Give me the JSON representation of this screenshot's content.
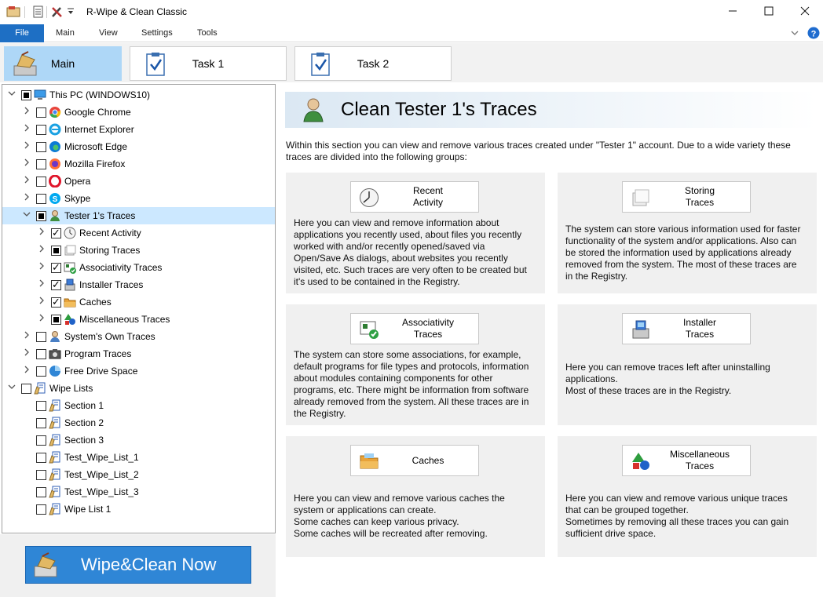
{
  "window": {
    "title": "R-Wipe & Clean Classic",
    "minimize_icon": "minimize-icon",
    "maximize_icon": "maximize-icon",
    "close_icon": "close-icon"
  },
  "quick_access": [
    "app-icon",
    "properties-icon",
    "tools-icon",
    "dropdown-icon"
  ],
  "menu": {
    "items": [
      "File",
      "Main",
      "View",
      "Settings",
      "Tools"
    ],
    "help_icon": "help-icon",
    "chevron": "chevron-down-icon"
  },
  "tabs": [
    {
      "label": "Main",
      "icon": "broom-icon",
      "active": true
    },
    {
      "label": "Task 1",
      "icon": "clipboard-check-icon",
      "active": false
    },
    {
      "label": "Task 2",
      "icon": "clipboard-check-icon",
      "active": false
    }
  ],
  "tree": [
    {
      "label": "This PC  (WINDOWS10)",
      "level": 0,
      "expander": "expanded",
      "check": "partial",
      "icon": "computer-icon"
    },
    {
      "label": "Google Chrome",
      "level": 1,
      "expander": "collapsed",
      "check": "unchecked",
      "icon": "chrome-icon"
    },
    {
      "label": "Internet  Explorer",
      "level": 1,
      "expander": "collapsed",
      "check": "unchecked",
      "icon": "ie-icon"
    },
    {
      "label": "Microsoft Edge",
      "level": 1,
      "expander": "collapsed",
      "check": "unchecked",
      "icon": "edge-icon"
    },
    {
      "label": "Mozilla Firefox",
      "level": 1,
      "expander": "collapsed",
      "check": "unchecked",
      "icon": "firefox-icon"
    },
    {
      "label": "Opera",
      "level": 1,
      "expander": "collapsed",
      "check": "unchecked",
      "icon": "opera-icon"
    },
    {
      "label": "Skype",
      "level": 1,
      "expander": "collapsed",
      "check": "unchecked",
      "icon": "skype-icon"
    },
    {
      "label": "Tester 1's Traces",
      "level": 1,
      "expander": "expanded",
      "check": "partial",
      "icon": "user-icon",
      "selected": true
    },
    {
      "label": "Recent Activity",
      "level": 2,
      "expander": "collapsed",
      "check": "checked",
      "icon": "clock-icon"
    },
    {
      "label": "Storing Traces",
      "level": 2,
      "expander": "collapsed",
      "check": "partial",
      "icon": "storage-icon"
    },
    {
      "label": "Associativity Traces",
      "level": 2,
      "expander": "collapsed",
      "check": "checked",
      "icon": "association-icon"
    },
    {
      "label": "Installer Traces",
      "level": 2,
      "expander": "collapsed",
      "check": "checked",
      "icon": "installer-icon"
    },
    {
      "label": "Caches",
      "level": 2,
      "expander": "collapsed",
      "check": "checked",
      "icon": "folder-icon"
    },
    {
      "label": "Miscellaneous Traces",
      "level": 2,
      "expander": "collapsed",
      "check": "partial",
      "icon": "shapes-icon"
    },
    {
      "label": "System's Own Traces",
      "level": 1,
      "expander": "collapsed",
      "check": "unchecked",
      "icon": "user-system-icon"
    },
    {
      "label": "Program Traces",
      "level": 1,
      "expander": "collapsed",
      "check": "unchecked",
      "icon": "camera-icon"
    },
    {
      "label": "Free Drive Space",
      "level": 1,
      "expander": "collapsed",
      "check": "unchecked",
      "icon": "pie-chart-icon"
    },
    {
      "label": "Wipe Lists",
      "level": 0,
      "expander": "expanded",
      "check": "unchecked",
      "icon": "wipe-list-icon"
    },
    {
      "label": "Section 1",
      "level": 1,
      "expander": "none",
      "check": "unchecked",
      "icon": "wipe-list-icon"
    },
    {
      "label": "Section 2",
      "level": 1,
      "expander": "none",
      "check": "unchecked",
      "icon": "wipe-list-icon"
    },
    {
      "label": "Section 3",
      "level": 1,
      "expander": "none",
      "check": "unchecked",
      "icon": "wipe-list-icon"
    },
    {
      "label": "Test_Wipe_List_1",
      "level": 1,
      "expander": "none",
      "check": "unchecked",
      "icon": "wipe-list-icon"
    },
    {
      "label": "Test_Wipe_List_2",
      "level": 1,
      "expander": "none",
      "check": "unchecked",
      "icon": "wipe-list-icon"
    },
    {
      "label": "Test_Wipe_List_3",
      "level": 1,
      "expander": "none",
      "check": "unchecked",
      "icon": "wipe-list-icon"
    },
    {
      "label": "Wipe List 1",
      "level": 1,
      "expander": "none",
      "check": "unchecked",
      "icon": "wipe-list-icon"
    }
  ],
  "wipe_button": {
    "label": "Wipe&Clean Now",
    "icon": "broom-icon"
  },
  "content": {
    "title": "Clean Tester 1's Traces",
    "title_icon": "user-icon",
    "intro": "Within this section you can view and remove various traces created under \"Tester 1\" account. Due to a wide variety these traces are divided into the following groups:",
    "cards": [
      {
        "button": "Recent\nActivity",
        "icon": "clock-icon",
        "text": "Here you can view and remove information about applications you recently used, about files you recently worked with and/or recently opened/saved via Open/Save As dialogs, about websites you recently visited, etc. Such traces are very often to be created but it's used to be contained in the Registry."
      },
      {
        "button": "Storing\nTraces",
        "icon": "storage-icon",
        "text": "The system can store various information used for faster functionality of the system and/or applications. Also can be stored the information used by applications already removed from the system. The most of these traces are in the Registry."
      },
      {
        "button": "Associativity\nTraces",
        "icon": "association-icon",
        "text": "The system can store some associations, for example, default programs for file types and protocols, information about modules containing components for other programs, etc. There might be information from software already removed from the system. All these traces are in the Registry."
      },
      {
        "button": "Installer\nTraces",
        "icon": "installer-icon",
        "text": "Here you can remove traces left after uninstalling applications.\nMost of these traces are in the Registry."
      },
      {
        "button": "Caches",
        "icon": "folder-icon",
        "text": "Here you can view and remove various caches the system or applications can create.\nSome caches can keep various privacy.\nSome caches will be recreated after removing."
      },
      {
        "button": "Miscellaneous\nTraces",
        "icon": "shapes-icon",
        "text": "Here you can view and remove various unique traces that can be grouped together.\nSometimes by removing all these traces you can gain sufficient drive space."
      }
    ]
  }
}
